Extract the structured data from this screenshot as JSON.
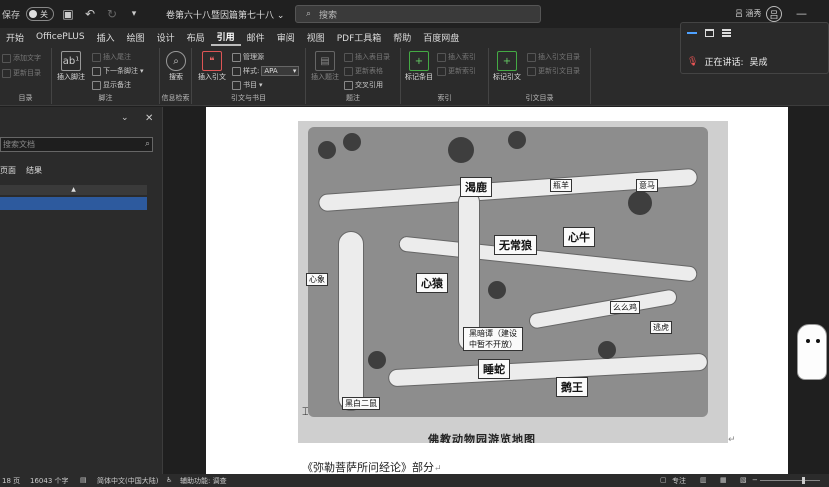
{
  "titlebar": {
    "autosave_label": "保存",
    "autosave_state": "关",
    "doc_title": "卷第六十八暨因篇第七十八",
    "search_placeholder": "搜索",
    "user_name": "吕 涵秀",
    "avatar_initial": "吕"
  },
  "tabs": [
    "开始",
    "OfficePLUS",
    "插入",
    "绘图",
    "设计",
    "布局",
    "引用",
    "邮件",
    "审阅",
    "视图",
    "PDF工具箱",
    "帮助",
    "百度网盘"
  ],
  "active_tab": "引用",
  "ribbon": {
    "toc": {
      "add_text": "添加文字",
      "update_toc": "更新目录",
      "label": "目录"
    },
    "footnotes": {
      "insert_footnote": "插入脚注",
      "insert_endnote": "插入尾注",
      "next_footnote": "下一条脚注",
      "show_notes": "显示备注",
      "label": "脚注"
    },
    "research": {
      "search": "搜索",
      "label": "信息检索"
    },
    "citations": {
      "insert_citation": "插入引文",
      "manage_sources": "管理源",
      "style_label": "样式:",
      "style_value": "APA",
      "bibliography": "书目",
      "label": "引文与书目"
    },
    "captions": {
      "insert_caption": "插入题注",
      "insert_table_of_figures": "插入表目录",
      "update_table": "更新表格",
      "cross_reference": "交叉引用",
      "label": "题注"
    },
    "index": {
      "mark_entry": "标记条目",
      "insert_index": "插入索引",
      "update_index": "更新索引",
      "label": "索引"
    },
    "toa": {
      "mark_citation": "标记引文",
      "insert_toa": "插入引文目录",
      "update_toa": "更新引文目录",
      "label": "引文目录"
    }
  },
  "nav_pane": {
    "search_placeholder": "搜索文档",
    "tabs": [
      "页面",
      "结果"
    ]
  },
  "map": {
    "labels": {
      "kelu": "渴鹿",
      "xiniu": "心牛",
      "wuchanglang": "无常狼",
      "xinyuan": "心猿",
      "xinxiang": "心象",
      "mingyang": "瓶羊",
      "xinma": "意马",
      "yaomoji": "么么鸡",
      "taohu": "逃虎",
      "shuishe": "睡蛇",
      "ewang": "鹅王",
      "heibaierdshu": "黑白二鼠",
      "construction": "黑暗谭（建设中暂不开放）"
    },
    "caption": "佛教动物园游览地图"
  },
  "doc_text": "《弥勒菩萨所问经论》部分",
  "meeting": {
    "speaking_label": "正在讲话:",
    "speaker": "吴成"
  },
  "statusbar": {
    "page": "18 页",
    "word_count": "16043 个字",
    "language": "简体中文(中国大陆)",
    "accessibility": "辅助功能: 调查",
    "focus": "专注"
  }
}
